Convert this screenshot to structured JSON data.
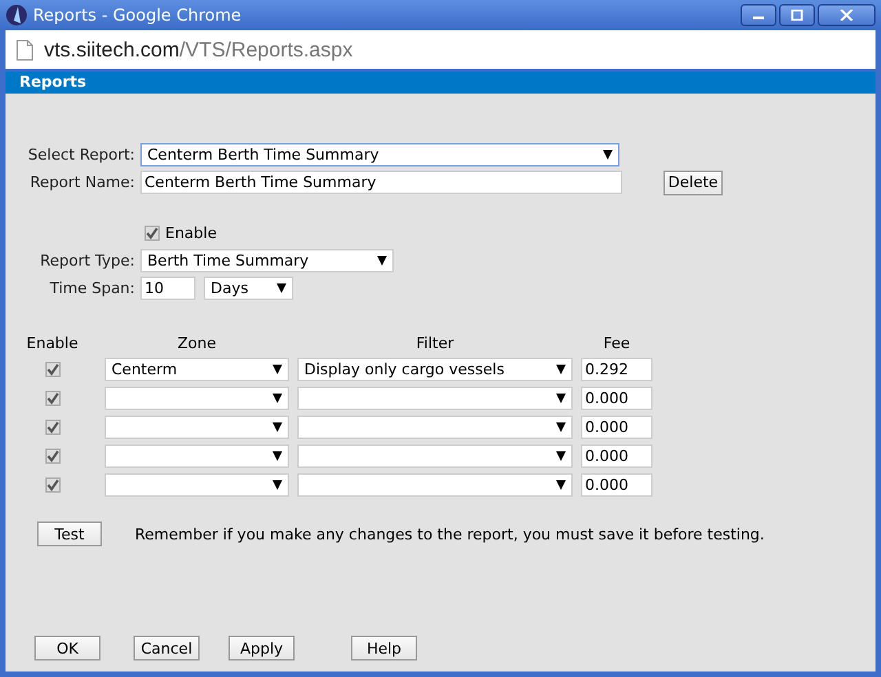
{
  "window": {
    "title": "Reports - Google Chrome"
  },
  "address_bar": {
    "host": "vts.siitech.com",
    "path": "/VTS/Reports.aspx"
  },
  "header": {
    "title": "Reports"
  },
  "form": {
    "select_report": {
      "label": "Select Report:",
      "value": "Centerm Berth Time Summary"
    },
    "report_name": {
      "label": "Report Name:",
      "value": "Centerm Berth Time Summary"
    },
    "delete_button": "Delete",
    "enable": {
      "label": "Enable",
      "checked": true
    },
    "report_type": {
      "label": "Report Type:",
      "value": "Berth Time Summary"
    },
    "time_span": {
      "label": "Time Span:",
      "value": "10",
      "unit": "Days"
    }
  },
  "table": {
    "columns": [
      "Enable",
      "Zone",
      "Filter",
      "Fee"
    ],
    "rows": [
      {
        "enabled": true,
        "zone": "Centerm",
        "filter": "Display only cargo vessels",
        "fee": "0.292"
      },
      {
        "enabled": true,
        "fee": "0.000"
      },
      {
        "enabled": true,
        "fee": "0.000"
      },
      {
        "enabled": true,
        "fee": "0.000"
      },
      {
        "enabled": true,
        "fee": "0.000"
      }
    ]
  },
  "test_button": "Test",
  "note": "Remember if you make any changes to the report, you must save it before testing.",
  "buttons": [
    "OK",
    "Cancel",
    "Apply",
    "Help"
  ]
}
